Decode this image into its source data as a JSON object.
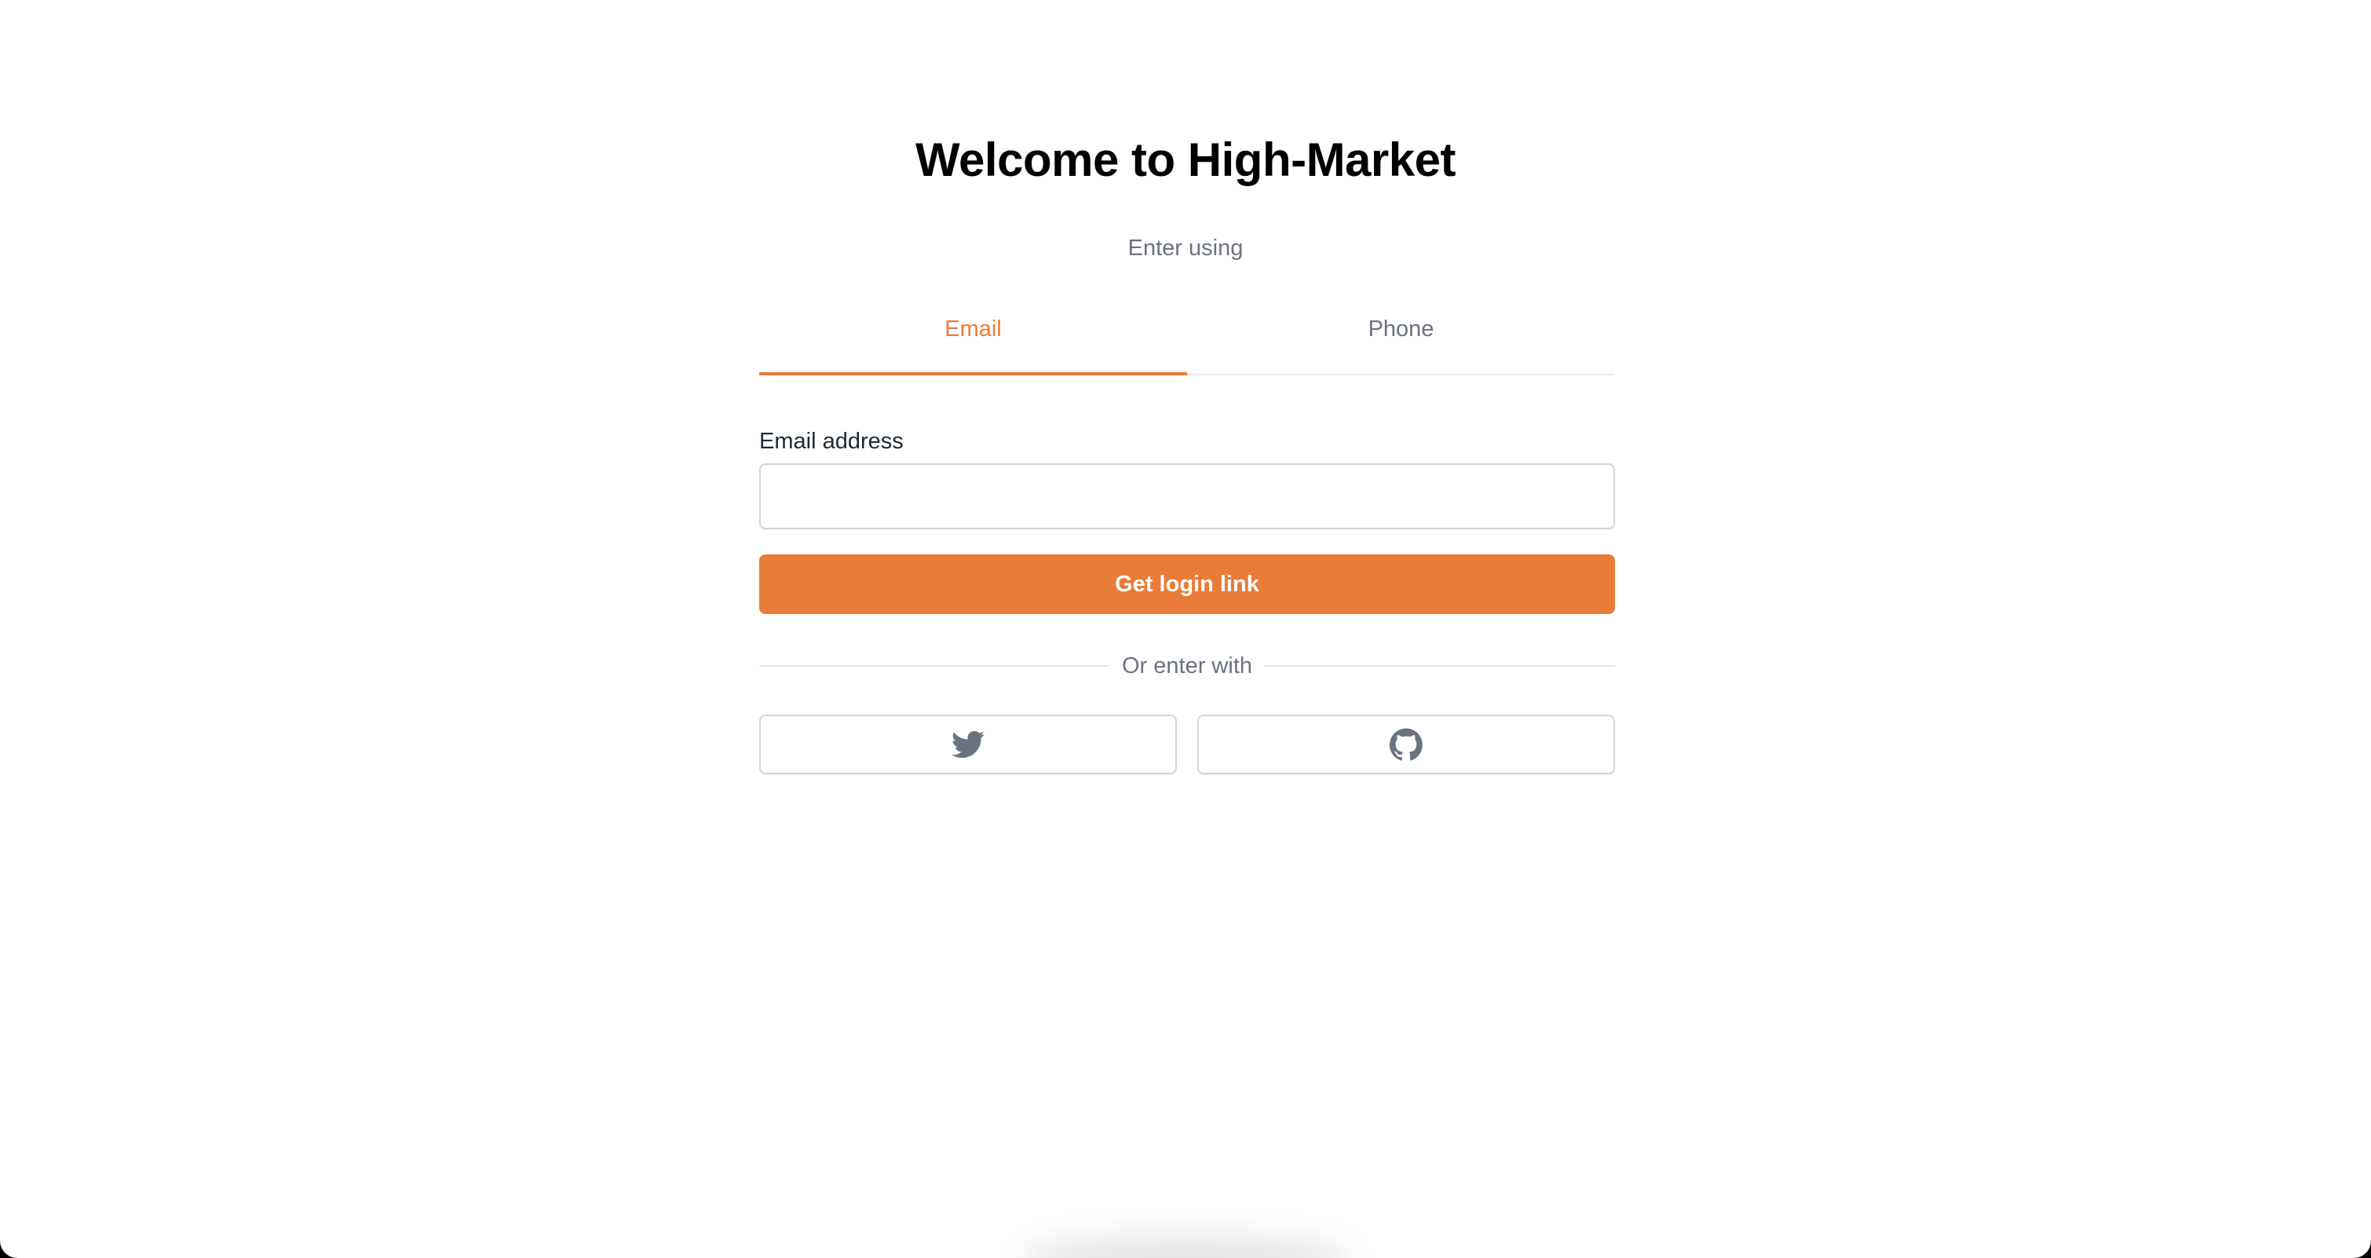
{
  "page": {
    "title": "Welcome to High-Market",
    "subtitle": "Enter using"
  },
  "tabs": [
    {
      "label": "Email",
      "active": true
    },
    {
      "label": "Phone",
      "active": false
    }
  ],
  "email_form": {
    "label": "Email address",
    "value": "",
    "placeholder": "",
    "submit_label": "Get login link"
  },
  "divider": {
    "text": "Or enter with"
  },
  "social": [
    {
      "icon": "twitter-icon"
    },
    {
      "icon": "github-icon"
    }
  ],
  "colors": {
    "accent": "#e87c38",
    "muted_text": "#6b7280",
    "border": "#d1d5db"
  }
}
